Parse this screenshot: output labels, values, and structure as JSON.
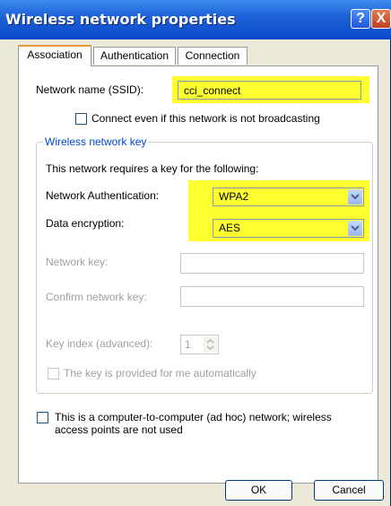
{
  "window": {
    "title": "Wireless network properties",
    "help_glyph": "?",
    "close_glyph": "X"
  },
  "tabs": [
    {
      "label": "Association"
    },
    {
      "label": "Authentication"
    },
    {
      "label": "Connection"
    }
  ],
  "association": {
    "ssid_label": "Network name (SSID):",
    "ssid_value": "cci_connect",
    "broadcast_label": "Connect even if this network is not broadcasting",
    "broadcast_checked": false
  },
  "wireless_key": {
    "group_label": "Wireless network key",
    "requirement_text": "This network requires a key for the following:",
    "auth_label": "Network Authentication:",
    "auth_value": "WPA2",
    "encryption_label": "Data encryption:",
    "encryption_value": "AES",
    "key_label": "Network key:",
    "confirm_label": "Confirm network key:",
    "index_label": "Key index (advanced):",
    "index_value": "1",
    "auto_label": "The key is provided for me automatically"
  },
  "adhoc": {
    "label": "This is a computer-to-computer (ad hoc) network; wireless access points are not used",
    "checked": false
  },
  "buttons": {
    "ok": "OK",
    "cancel": "Cancel"
  },
  "colors": {
    "highlight": "#ffff30",
    "titlebar": "#0a48c8",
    "group_label": "#0046d5"
  }
}
